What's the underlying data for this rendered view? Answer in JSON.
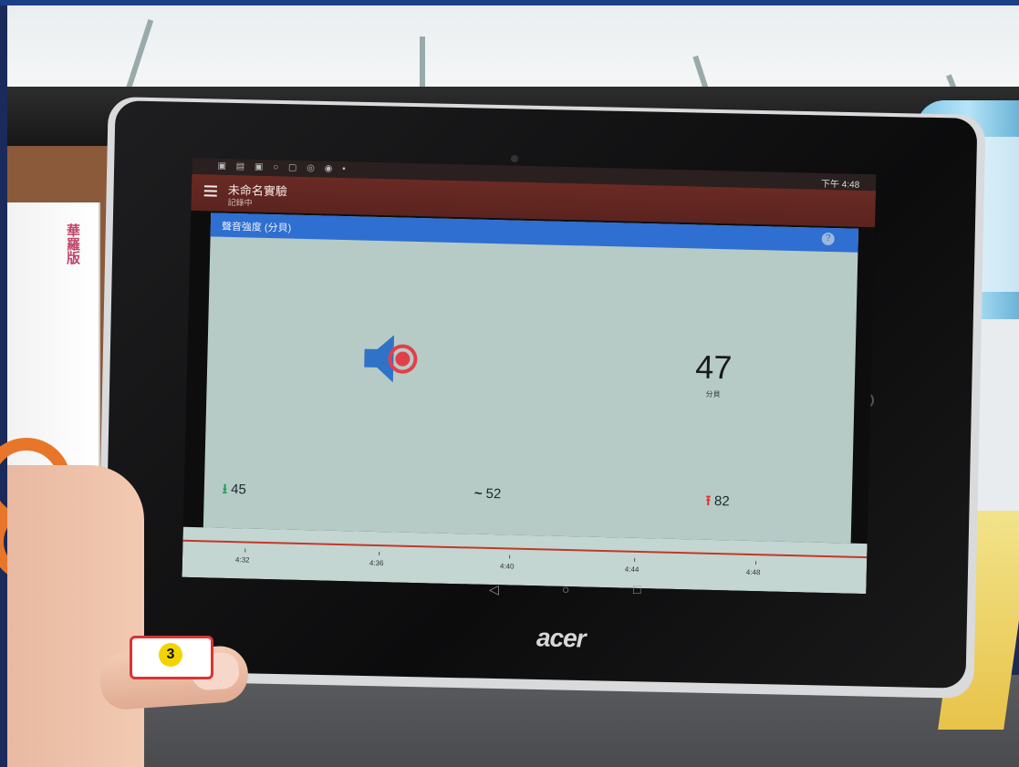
{
  "statusbar": {
    "icons": "▣ ▤ ▣ ○ ▢ ◎ ◉ ▪",
    "clock": "下午 4:48"
  },
  "appbar": {
    "title": "未命名實驗",
    "subtitle": "記錄中"
  },
  "card": {
    "title": "聲音強度 (分貝)",
    "help_icon": "?",
    "current_value": "47",
    "current_unit": "分貝",
    "min_value": "45",
    "avg_value": "52",
    "max_value": "82"
  },
  "chart_ticks": [
    "4:32",
    "4:36",
    "4:40",
    "4:44",
    "4:48"
  ],
  "navbar": {
    "back": "◁",
    "home": "○",
    "recents": "□"
  },
  "device": {
    "brand": "acer"
  },
  "book": {
    "title": "華羅版"
  },
  "sticker": {
    "number": "3"
  },
  "colors": {
    "appbar": "#5b231f",
    "card_header": "#2e6fd1",
    "card_bg": "#b6cbc5",
    "speaker_blue": "#2e73c8",
    "speaker_red": "#e0404a",
    "chart_line": "#c0392b"
  }
}
